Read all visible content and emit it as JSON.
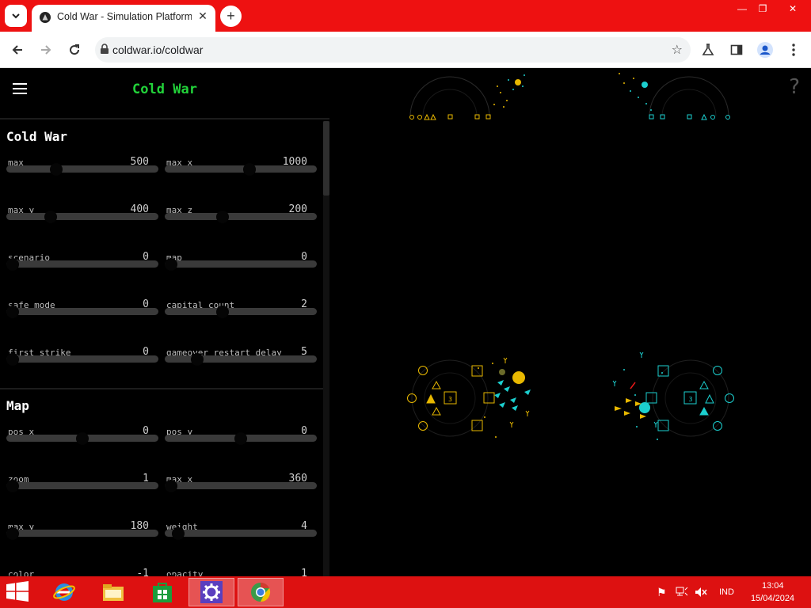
{
  "browser": {
    "tab_title": "Cold War - Simulation Platform",
    "url": "coldwar.io/coldwar",
    "tab_close": "✕",
    "new_tab": "+",
    "window_controls": {
      "minimize": "—",
      "restore": "❐",
      "close": "✕"
    }
  },
  "app": {
    "title": "Cold War",
    "help": "?"
  },
  "sections": [
    {
      "title": "Cold War",
      "params": [
        {
          "name": "max",
          "value": "500",
          "level": 0.31
        },
        {
          "name": "max_x",
          "value": "1000",
          "level": 0.56
        },
        {
          "name": "max_y",
          "value": "400",
          "level": 0.27
        },
        {
          "name": "max_z",
          "value": "200",
          "level": 0.37
        },
        {
          "name": "scenario",
          "value": "0",
          "level": 0.0
        },
        {
          "name": "map",
          "value": "0",
          "level": 0.0
        },
        {
          "name": "safe_mode",
          "value": "0",
          "level": 0.0
        },
        {
          "name": "capital_count",
          "value": "2",
          "level": 0.37
        },
        {
          "name": "first_strike",
          "value": "0",
          "level": 0.0
        },
        {
          "name": "gameover_restart_delay",
          "value": "5",
          "level": 0.19
        }
      ]
    },
    {
      "title": "Map",
      "params": [
        {
          "name": "pos_x",
          "value": "0",
          "level": 0.5
        },
        {
          "name": "pos_y",
          "value": "0",
          "level": 0.5
        },
        {
          "name": "zoom",
          "value": "1",
          "level": 0.0
        },
        {
          "name": "max_x",
          "value": "360",
          "level": 0.0
        },
        {
          "name": "max_y",
          "value": "180",
          "level": 0.0
        },
        {
          "name": "weight",
          "value": "4",
          "level": 0.05
        },
        {
          "name": "color",
          "value": "-1",
          "level": 0.0
        },
        {
          "name": "opacity",
          "value": "1",
          "level": 0.0
        }
      ]
    }
  ],
  "arena": {
    "colors": {
      "yellow_team": "#e8b800",
      "cyan_team": "#1ccfcf"
    },
    "bases": [
      {
        "team": "yellow",
        "center_label": "3"
      },
      {
        "team": "cyan",
        "center_label": "3"
      }
    ]
  },
  "taskbar": {
    "language": "IND",
    "time": "13:04",
    "date": "15/04/2024"
  }
}
